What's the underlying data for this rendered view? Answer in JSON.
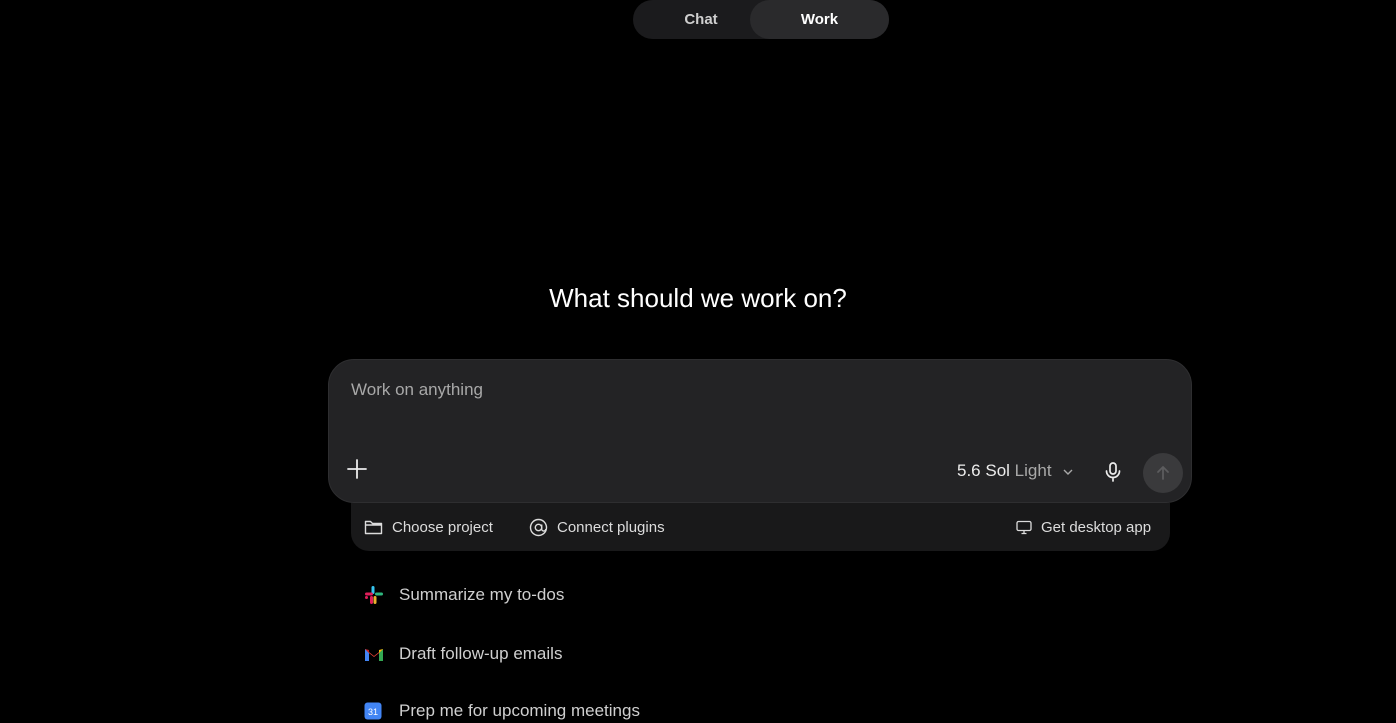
{
  "mode_toggle": {
    "tabs": [
      {
        "label": "Chat",
        "selected": false
      },
      {
        "label": "Work",
        "selected": true
      }
    ]
  },
  "heading": "What should we work on?",
  "composer": {
    "placeholder": "Work on anything",
    "value": "",
    "model": {
      "name": "5.6 Sol",
      "effort": "Light"
    }
  },
  "tray": {
    "choose_project": "Choose project",
    "connect_plugins": "Connect plugins",
    "get_desktop_app": "Get desktop app"
  },
  "suggestions": [
    {
      "label": "Summarize my to-dos",
      "icon": "slack-icon"
    },
    {
      "label": "Draft follow-up emails",
      "icon": "gmail-icon"
    },
    {
      "label": "Prep me for upcoming meetings",
      "icon": "calendar-icon",
      "icon_text": "31"
    }
  ],
  "colors": {
    "background": "#000000",
    "composer": "#232325",
    "tray": "#19191a",
    "send_button": "#3a3a3c"
  }
}
